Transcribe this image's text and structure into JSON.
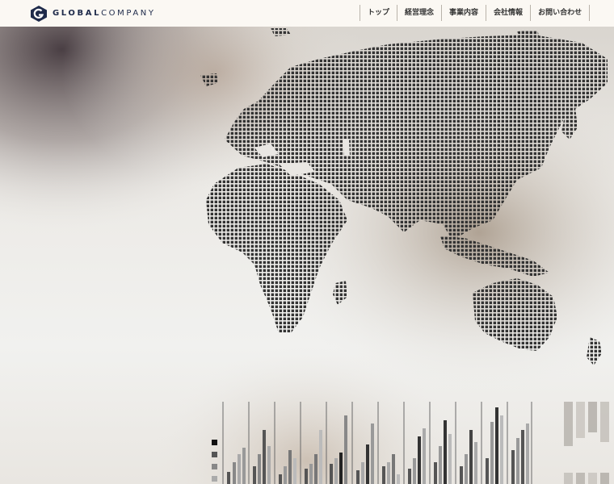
{
  "logo": {
    "bold": "GLOBAL",
    "light": "COMPANY"
  },
  "nav": [
    {
      "label": "トップ"
    },
    {
      "label": "経営理念"
    },
    {
      "label": "事業内容"
    },
    {
      "label": "会社情報"
    },
    {
      "label": "お問い合わせ"
    }
  ],
  "colors": {
    "brand": "#1e2a4a",
    "header_bg": "#fbf8f3",
    "dots": "#3a3a3a"
  },
  "hero": {
    "image": "dotted-world-map-with-bar-charts"
  }
}
